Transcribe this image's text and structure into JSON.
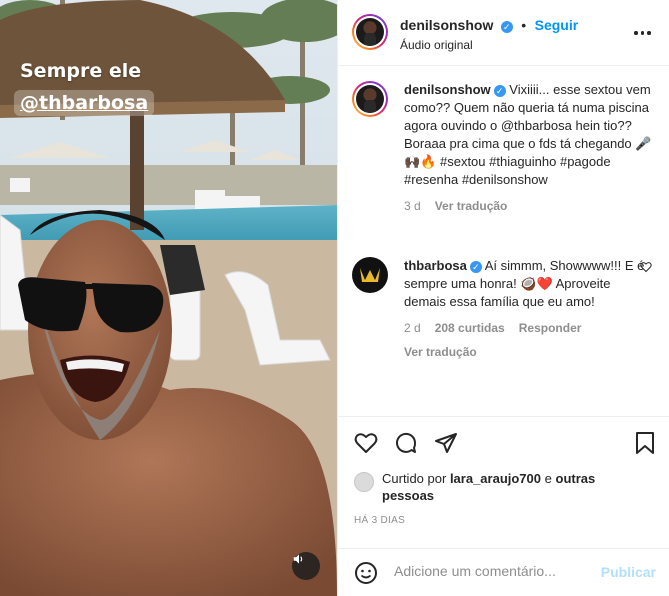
{
  "media": {
    "overlay_line1": "Sempre ele",
    "overlay_line2": "@thbarbosa",
    "audio_icon": "speaker-icon"
  },
  "header": {
    "username": "denilsonshow",
    "verified": true,
    "separator": "•",
    "follow_label": "Seguir",
    "audio_label": "Áudio original",
    "more_icon": "more-options-icon"
  },
  "caption": {
    "username": "denilsonshow",
    "text": "Vixiiii... esse sextou vem como?? Quem não queria tá numa piscina agora ouvindo o @thbarbosa hein tio?? Boraaa pra cima que o fds tá chegando 🎤🙌🏿🔥 #sextou #thiaguinho #pagode #resenha #denilsonshow",
    "time": "3 d",
    "translate_label": "Ver tradução"
  },
  "comment": {
    "username": "thbarbosa",
    "text": "Aí simmm, Showwww!!! E é sempre uma honra! 🥥❤️ Aproveite demais essa família que eu amo!",
    "time": "2 d",
    "likes": "208 curtidas",
    "reply_label": "Responder",
    "translate_label": "Ver tradução"
  },
  "likes": {
    "prefix": "Curtido por",
    "user": "lara_araujo700",
    "suffix_connector": "e",
    "others": "outras pessoas"
  },
  "date_label": "HÁ 3 DIAS",
  "comment_box": {
    "placeholder": "Adicione um comentário...",
    "post_label": "Publicar"
  },
  "colors": {
    "accent": "#0095f6",
    "verified": "#3897f0",
    "muted": "#8e8e8e",
    "heart_red": "#ed4956",
    "post_disabled": "#b2dffc"
  }
}
